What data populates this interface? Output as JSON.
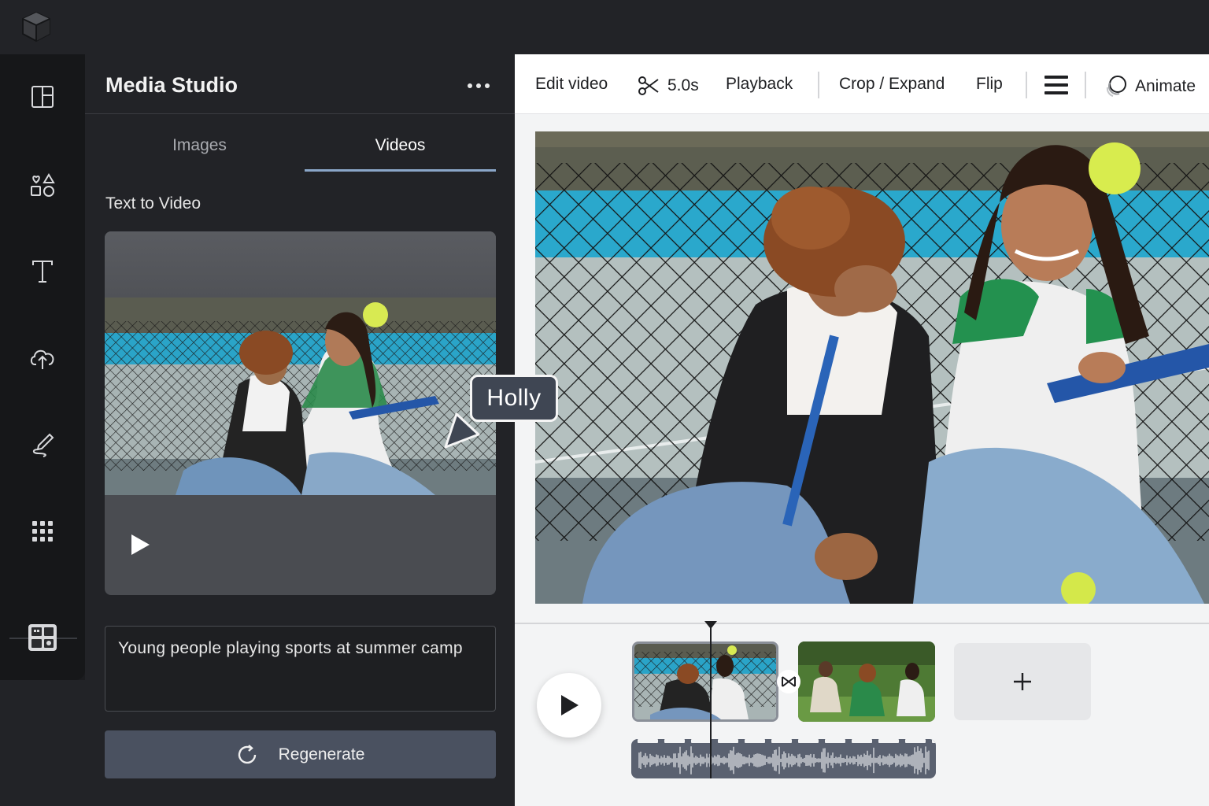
{
  "app": {
    "logo_icon": "cube-logo-icon"
  },
  "rail": {
    "items": [
      {
        "name": "layout-icon"
      },
      {
        "name": "elements-icon"
      },
      {
        "name": "text-icon"
      },
      {
        "name": "upload-icon"
      },
      {
        "name": "draw-icon"
      },
      {
        "name": "apps-icon"
      },
      {
        "name": "media-studio-icon"
      }
    ]
  },
  "panel": {
    "title": "Media Studio",
    "tabs": [
      {
        "label": "Images",
        "active": false
      },
      {
        "label": "Videos",
        "active": true
      }
    ],
    "section_label": "Text to Video",
    "prompt_value": "Young people playing sports at summer camp",
    "regenerate_label": "Regenerate"
  },
  "toolbar": {
    "edit_video": "Edit video",
    "duration": "5.0s",
    "playback": "Playback",
    "crop_expand": "Crop / Expand",
    "flip": "Flip",
    "animate": "Animate"
  },
  "collaborator": {
    "name": "Holly"
  },
  "colors": {
    "accent_tab": "#8aa6c8",
    "dark_bg": "#222327",
    "cursor_tag": "#3f4653"
  }
}
